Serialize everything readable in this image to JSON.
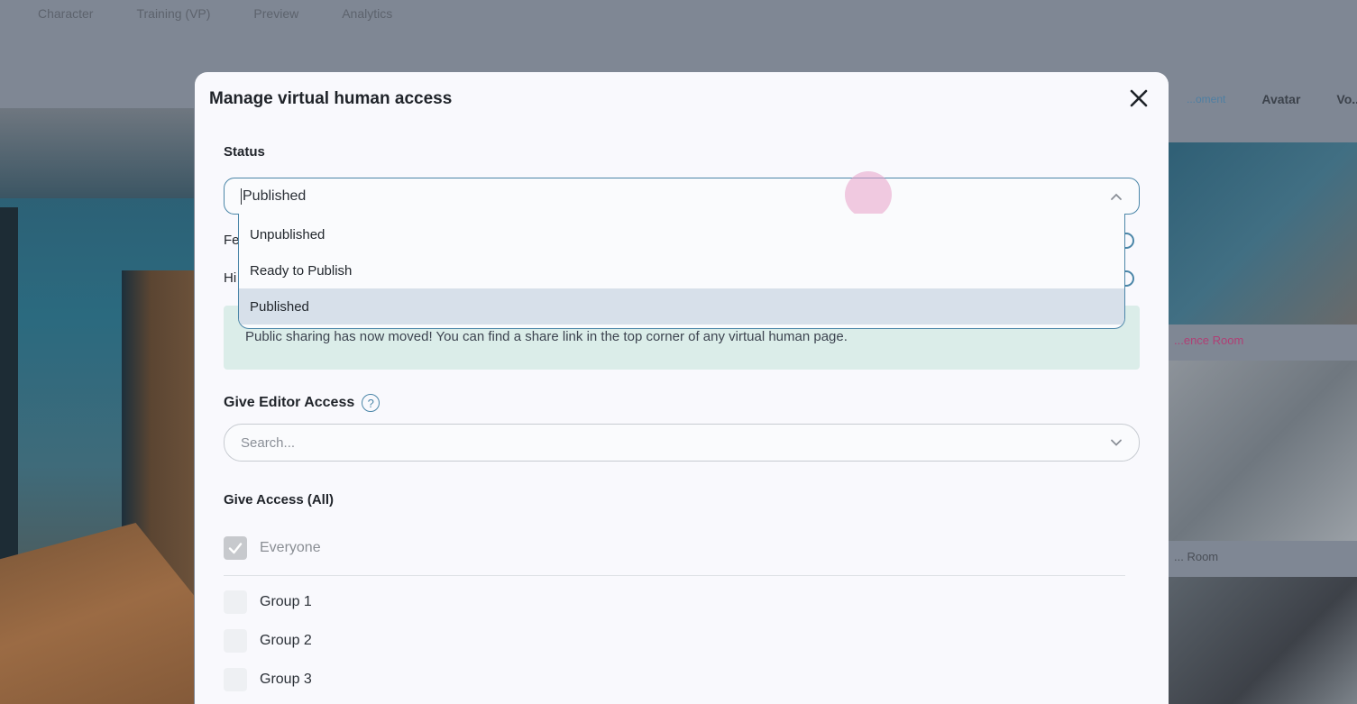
{
  "background": {
    "top_tabs": [
      "Character",
      "Training (VP)",
      "Preview",
      "Analytics"
    ],
    "right_tabs": [
      "...oment",
      "Avatar",
      "Vo..."
    ],
    "captions": [
      "...ence Room",
      "... Room"
    ]
  },
  "modal": {
    "title": "Manage virtual human access",
    "status": {
      "label": "Status",
      "value": "Published",
      "options": [
        "Unpublished",
        "Ready to Publish",
        "Published"
      ],
      "selected_option": "Published"
    },
    "hidden_rows": [
      "Fe",
      "Hi"
    ],
    "info_banner": "Public sharing has now moved! You can find a share link in the top corner of any virtual human page.",
    "editor_access": {
      "label": "Give Editor Access",
      "help_glyph": "?",
      "search_placeholder": "Search..."
    },
    "give_access": {
      "label": "Give Access (All)",
      "everyone": {
        "label": "Everyone",
        "checked": true
      },
      "groups": [
        {
          "label": "Group 1",
          "checked": false
        },
        {
          "label": "Group 2",
          "checked": false
        },
        {
          "label": "Group 3",
          "checked": false
        }
      ]
    }
  },
  "colors": {
    "accent": "#4b86a8",
    "overlay": "#7f8794",
    "banner": "#dbede9",
    "selected_option": "#d7e0ea"
  }
}
